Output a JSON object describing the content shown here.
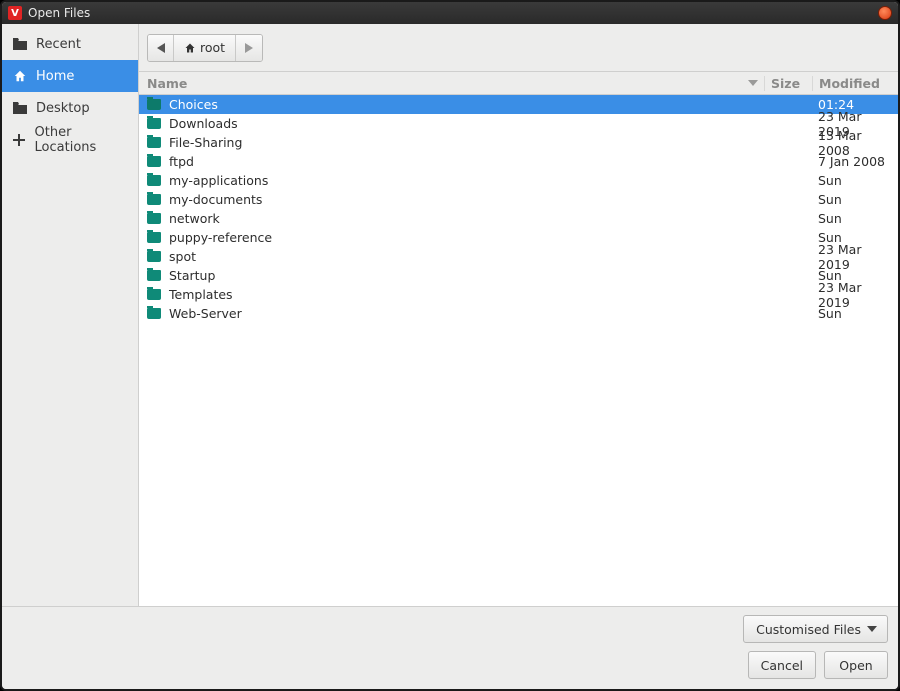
{
  "window": {
    "title": "Open Files"
  },
  "sidebar": {
    "items": [
      {
        "id": "recent",
        "label": "Recent",
        "icon": "folder-dark",
        "active": false
      },
      {
        "id": "home",
        "label": "Home",
        "icon": "home",
        "active": true
      },
      {
        "id": "desktop",
        "label": "Desktop",
        "icon": "folder-dark",
        "active": false
      },
      {
        "id": "other",
        "label": "Other Locations",
        "icon": "plus",
        "active": false
      }
    ]
  },
  "toolbar": {
    "breadcrumb": [
      {
        "label": "root",
        "icon": "home"
      }
    ]
  },
  "columns": {
    "name": "Name",
    "size": "Size",
    "modified": "Modified"
  },
  "files": [
    {
      "name": "Choices",
      "size": "",
      "modified": "01:24",
      "selected": true
    },
    {
      "name": "Downloads",
      "size": "",
      "modified": "23 Mar 2019",
      "selected": false
    },
    {
      "name": "File-Sharing",
      "size": "",
      "modified": "13 Mar 2008",
      "selected": false
    },
    {
      "name": "ftpd",
      "size": "",
      "modified": "7 Jan 2008",
      "selected": false
    },
    {
      "name": "my-applications",
      "size": "",
      "modified": "Sun",
      "selected": false
    },
    {
      "name": "my-documents",
      "size": "",
      "modified": "Sun",
      "selected": false
    },
    {
      "name": "network",
      "size": "",
      "modified": "Sun",
      "selected": false
    },
    {
      "name": "puppy-reference",
      "size": "",
      "modified": "Sun",
      "selected": false
    },
    {
      "name": "spot",
      "size": "",
      "modified": "23 Mar 2019",
      "selected": false
    },
    {
      "name": "Startup",
      "size": "",
      "modified": "Sun",
      "selected": false
    },
    {
      "name": "Templates",
      "size": "",
      "modified": "23 Mar 2019",
      "selected": false
    },
    {
      "name": "Web-Server",
      "size": "",
      "modified": "Sun",
      "selected": false
    }
  ],
  "footer": {
    "filter_label": "Customised Files",
    "cancel_label": "Cancel",
    "open_label": "Open"
  }
}
